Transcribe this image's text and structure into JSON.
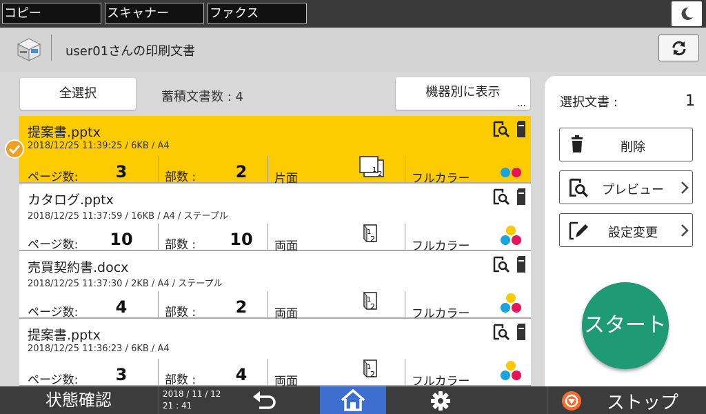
{
  "tabs": [
    {
      "label": "コピー"
    },
    {
      "label": "スキャナー"
    },
    {
      "label": "ファクス"
    }
  ],
  "header": {
    "title": "user01さんの印刷文書"
  },
  "actions": {
    "select_all": "全選択",
    "stored_count": "蓄積文書数 : 4",
    "by_device": "機器別に表示",
    "by_device_more": "..."
  },
  "documents": [
    {
      "name": "提案書.pptx",
      "meta": "2018/12/25 11:39:25 / 6KB / A4",
      "pages_label": "ページ数:",
      "pages": "3",
      "copies_label": "部数 :",
      "copies": "2",
      "sides": "片面",
      "color": "フルカラー",
      "selected": true
    },
    {
      "name": "カタログ.pptx",
      "meta": "2018/12/25 11:37:59 / 16KB / A4 / ステープル",
      "pages_label": "ページ数:",
      "pages": "10",
      "copies_label": "部数 :",
      "copies": "10",
      "sides": "両面",
      "color": "フルカラー",
      "selected": false
    },
    {
      "name": "売買契約書.docx",
      "meta": "2018/12/25 11:37:30 / 2KB / A4 / ステープル",
      "pages_label": "ページ数:",
      "pages": "4",
      "copies_label": "部数 :",
      "copies": "2",
      "sides": "両面",
      "color": "フルカラー",
      "selected": false
    },
    {
      "name": "提案書.pptx",
      "meta": "2018/12/25 11:36:23 / 6KB / A4",
      "pages_label": "ページ数:",
      "pages": "3",
      "copies_label": "部数 :",
      "copies": "4",
      "sides": "両面",
      "color": "フルカラー",
      "selected": false
    }
  ],
  "side_panel": {
    "selected_label": "選択文書 :",
    "selected_count": "1",
    "delete_label": "削除",
    "preview_label": "プレビュー",
    "settings_label": "設定変更",
    "start_label": "スタート"
  },
  "footer": {
    "status_label": "状態確認",
    "date": "2018 / 11 / 12",
    "time": "21 : 41",
    "stop_label": "ストップ"
  },
  "colors": {
    "topbar": "#3a3a3a",
    "selected_row": "#fccc00",
    "start_button": "#1e9a74",
    "home_button": "#3d6fd1",
    "check_orange": "#f0a020",
    "stop_orange": "#ff6a2a"
  },
  "icons": [
    "moon-icon",
    "printer-app-icon",
    "refresh-icon",
    "preview-icon",
    "document-icon",
    "duplex-icon",
    "full-color-icon",
    "trash-icon",
    "edit-icon",
    "chevron-right-icon",
    "back-icon",
    "home-icon",
    "gear-icon",
    "stop-icon",
    "check-icon"
  ]
}
